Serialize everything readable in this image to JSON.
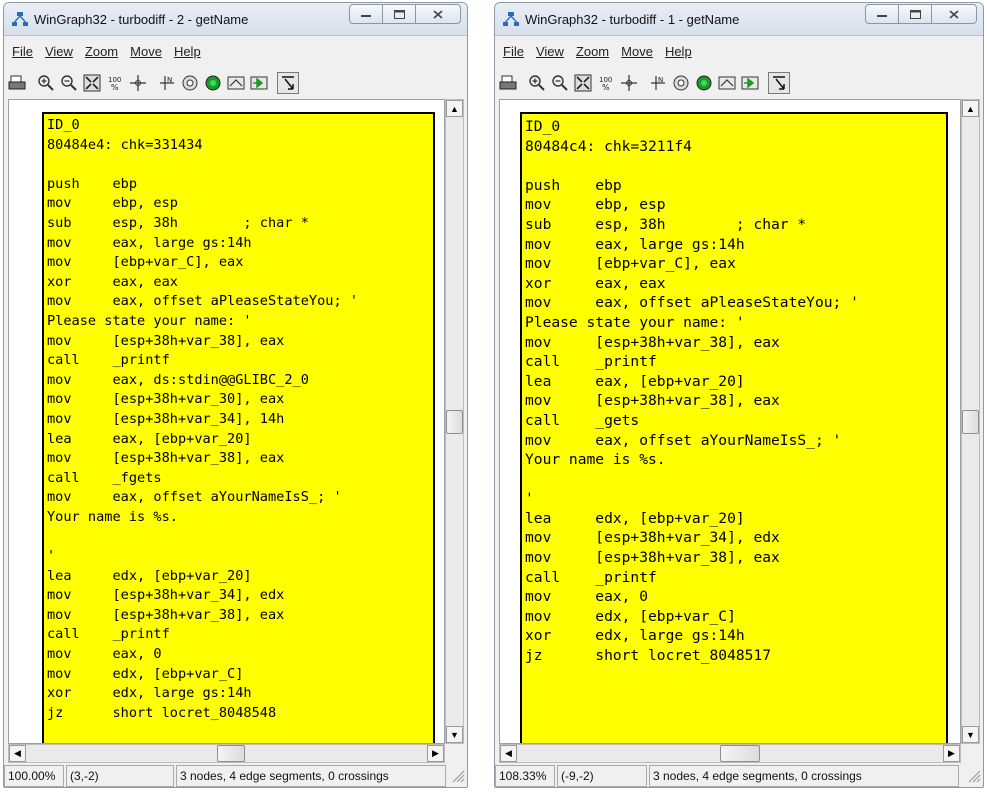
{
  "windows": [
    {
      "title": "WinGraph32 - turbodiff - 2 - getName",
      "menu": [
        "File",
        "View",
        "Zoom",
        "Move",
        "Help"
      ],
      "node_lines": [
        "ID_0",
        "80484e4: chk=331434",
        "",
        "push    ebp",
        "mov     ebp, esp",
        "sub     esp, 38h        ; char *",
        "mov     eax, large gs:14h",
        "mov     [ebp+var_C], eax",
        "xor     eax, eax",
        "mov     eax, offset aPleaseStateYou; '",
        "Please state your name: '",
        "mov     [esp+38h+var_38], eax",
        "call    _printf",
        "mov     eax, ds:stdin@@GLIBC_2_0",
        "mov     [esp+38h+var_30], eax",
        "mov     [esp+38h+var_34], 14h",
        "lea     eax, [ebp+var_20]",
        "mov     [esp+38h+var_38], eax",
        "call    _fgets",
        "mov     eax, offset aYourNameIsS_; '",
        "Your name is %s.",
        "",
        "'",
        "lea     edx, [ebp+var_20]",
        "mov     [esp+38h+var_34], edx",
        "mov     [esp+38h+var_38], eax",
        "call    _printf",
        "mov     eax, 0",
        "mov     edx, [ebp+var_C]",
        "xor     edx, large gs:14h",
        "jz      short locret_8048548"
      ],
      "status": {
        "zoom": "100.00%",
        "coords": "(3,-2)",
        "info": "3 nodes, 4 edge segments, 0 crossings"
      }
    },
    {
      "title": "WinGraph32 - turbodiff - 1 - getName",
      "menu": [
        "File",
        "View",
        "Zoom",
        "Move",
        "Help"
      ],
      "node_lines": [
        "ID_0",
        "80484c4: chk=3211f4",
        "",
        "push    ebp",
        "mov     ebp, esp",
        "sub     esp, 38h        ; char *",
        "mov     eax, large gs:14h",
        "mov     [ebp+var_C], eax",
        "xor     eax, eax",
        "mov     eax, offset aPleaseStateYou; '",
        "Please state your name: '",
        "mov     [esp+38h+var_38], eax",
        "call    _printf",
        "lea     eax, [ebp+var_20]",
        "mov     [esp+38h+var_38], eax",
        "call    _gets",
        "mov     eax, offset aYourNameIsS_; '",
        "Your name is %s.",
        "",
        "'",
        "lea     edx, [ebp+var_20]",
        "mov     [esp+38h+var_34], edx",
        "mov     [esp+38h+var_38], eax",
        "call    _printf",
        "mov     eax, 0",
        "mov     edx, [ebp+var_C]",
        "xor     edx, large gs:14h",
        "jz      short locret_8048517"
      ],
      "status": {
        "zoom": "108.33%",
        "coords": "(-9,-2)",
        "info": "3 nodes, 4 edge segments, 0 crossings"
      }
    }
  ],
  "colors": {
    "node_fill": "#ffff00",
    "node_border": "#000000",
    "canvas_bg": "#ffffff"
  },
  "toolbar_icons": [
    "print-icon",
    "zoom-in-icon",
    "zoom-out-icon",
    "fit-window-icon",
    "zoom-100-icon",
    "center-icon",
    "position-icon",
    "orbit-icon",
    "green-dot-icon",
    "edge-icon",
    "green-arrow-icon",
    "pointer-icon"
  ]
}
